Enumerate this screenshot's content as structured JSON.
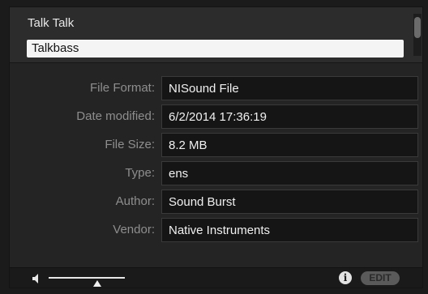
{
  "list": {
    "items": [
      {
        "label": "Talk Talk"
      },
      {
        "label": "Talkbass",
        "selected": true
      }
    ]
  },
  "info": {
    "rows": [
      {
        "label": "File Format:",
        "value": "NISound File"
      },
      {
        "label": "Date modified:",
        "value": "6/2/2014 17:36:19"
      },
      {
        "label": "File Size:",
        "value": "8.2 MB"
      },
      {
        "label": "Type:",
        "value": "ens"
      },
      {
        "label": "Author:",
        "value": "Sound Burst"
      },
      {
        "label": "Vendor:",
        "value": "Native Instruments"
      }
    ]
  },
  "bottombar": {
    "volume_level": 0.6,
    "info_icon": "i",
    "edit_label": "EDIT"
  },
  "colors": {
    "selected_bg": "#f4f4f4",
    "panel_bg": "#242424",
    "field_bg": "#151515"
  }
}
